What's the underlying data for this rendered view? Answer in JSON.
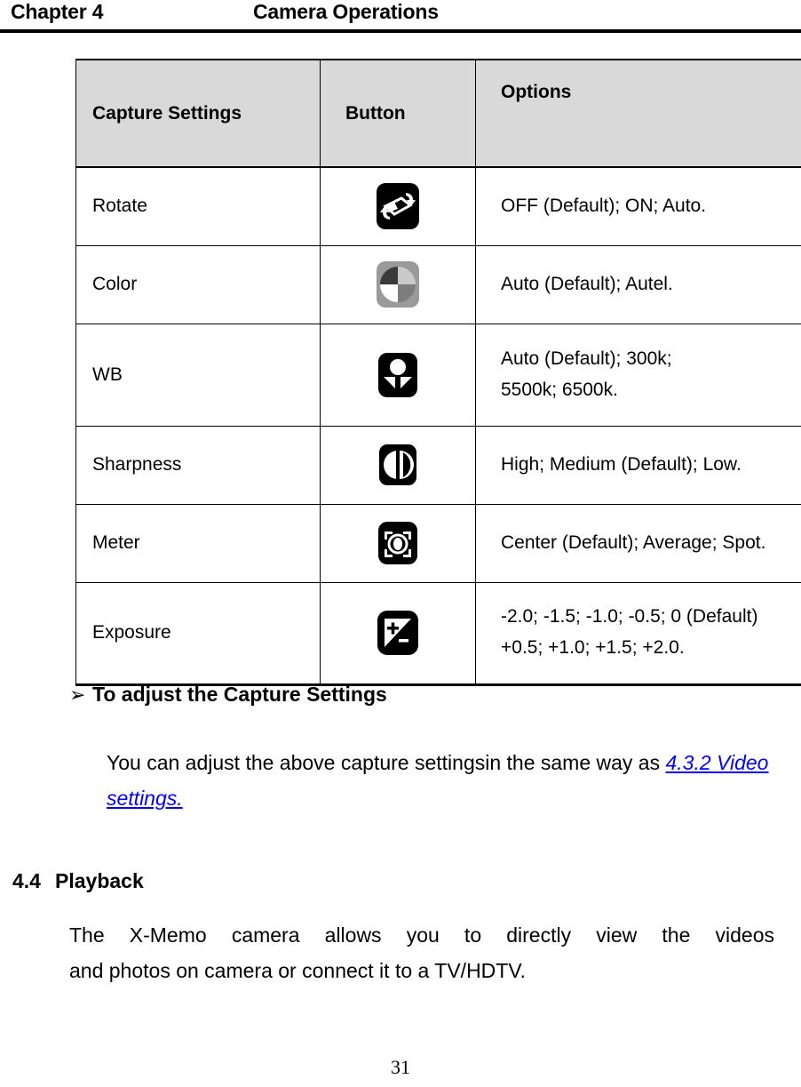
{
  "header": {
    "chapter": "Chapter 4",
    "title": "Camera Operations"
  },
  "table": {
    "columns": [
      "Capture Settings",
      "Button",
      "Options"
    ],
    "rows": [
      {
        "name": "Rotate",
        "icon": "rotate-icon",
        "options": [
          "OFF (Default); ON; Auto."
        ]
      },
      {
        "name": "Color",
        "icon": "color-icon",
        "options": [
          "Auto (Default); Autel."
        ]
      },
      {
        "name": "WB",
        "icon": "white-balance-icon",
        "options": [
          "Auto (Default); 300k;",
          "5500k; 6500k."
        ]
      },
      {
        "name": "Sharpness",
        "icon": "sharpness-icon",
        "options": [
          "High; Medium (Default); Low."
        ]
      },
      {
        "name": "Meter",
        "icon": "meter-icon",
        "options": [
          "Center (Default); Average; Spot."
        ]
      },
      {
        "name": "Exposure",
        "icon": "exposure-icon",
        "options": [
          "-2.0; -1.5; -1.0; -0.5; 0 (Default)",
          "+0.5; +1.0; +1.5; +2.0."
        ]
      }
    ]
  },
  "body": {
    "bullet_glyph": "➢",
    "bullet_heading": "To adjust the Capture Settings",
    "adjust_text_before": "You can adjust the above capture settingsin the same way as ",
    "adjust_link": "4.3.2 Video settings.",
    "section_number": "4.4",
    "section_title": "Playback",
    "playback_line1": "The X-Memo camera allows you to directly view the videos",
    "playback_line2": "and photos on camera or connect it to a TV/HDTV."
  },
  "footer": {
    "page_number": "31"
  },
  "colors": {
    "header_fill": "#d9d9d9",
    "link": "#0000ff",
    "rule": "#000000"
  }
}
